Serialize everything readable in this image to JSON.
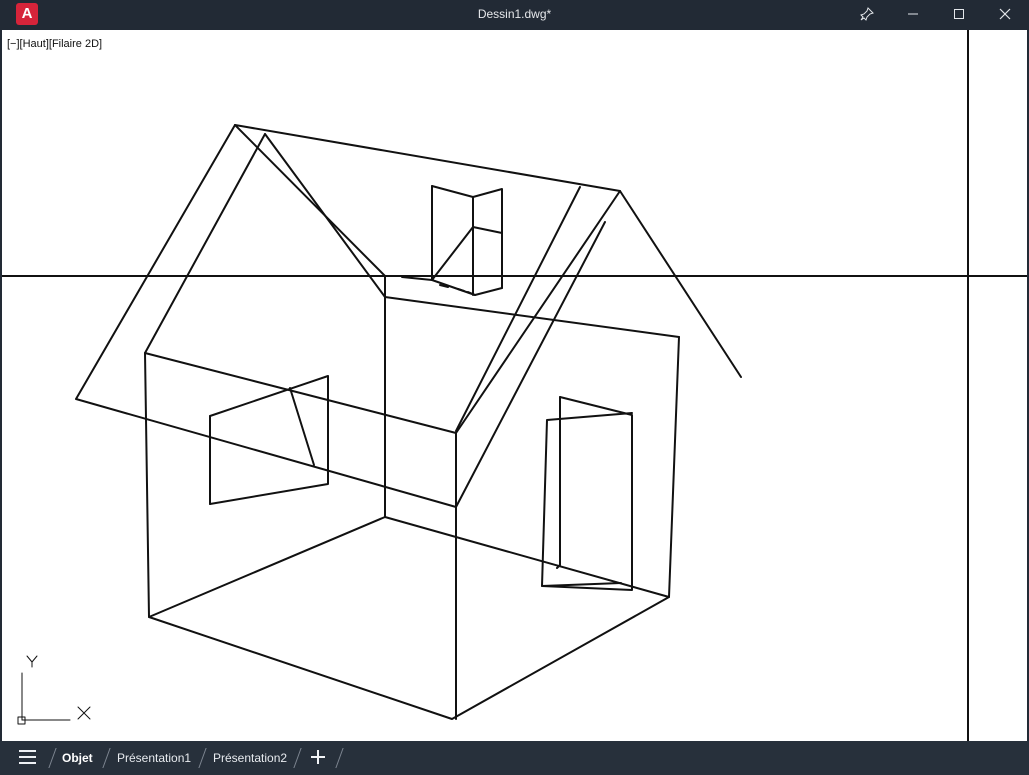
{
  "window": {
    "app_icon_letter": "A",
    "title": "Dessin1.dwg*"
  },
  "viewport": {
    "label": "[−][Haut][Filaire 2D]",
    "ucs_x_label": "X",
    "ucs_y_label": "Y"
  },
  "tabs": [
    {
      "label": "Objet",
      "active": true
    },
    {
      "label": "Présentation1",
      "active": false
    },
    {
      "label": "Présentation2",
      "active": false
    }
  ],
  "colors": {
    "title_bar": "#222a35",
    "tab_bar": "#27303b",
    "app_icon": "#d6243a",
    "drawing_lines": "#111111"
  },
  "icons": {
    "pin": "pin-icon",
    "minimize": "minimize-icon",
    "maximize": "maximize-icon",
    "close": "close-icon",
    "menu": "hamburger-menu-icon",
    "add_tab": "add-tab-icon"
  }
}
